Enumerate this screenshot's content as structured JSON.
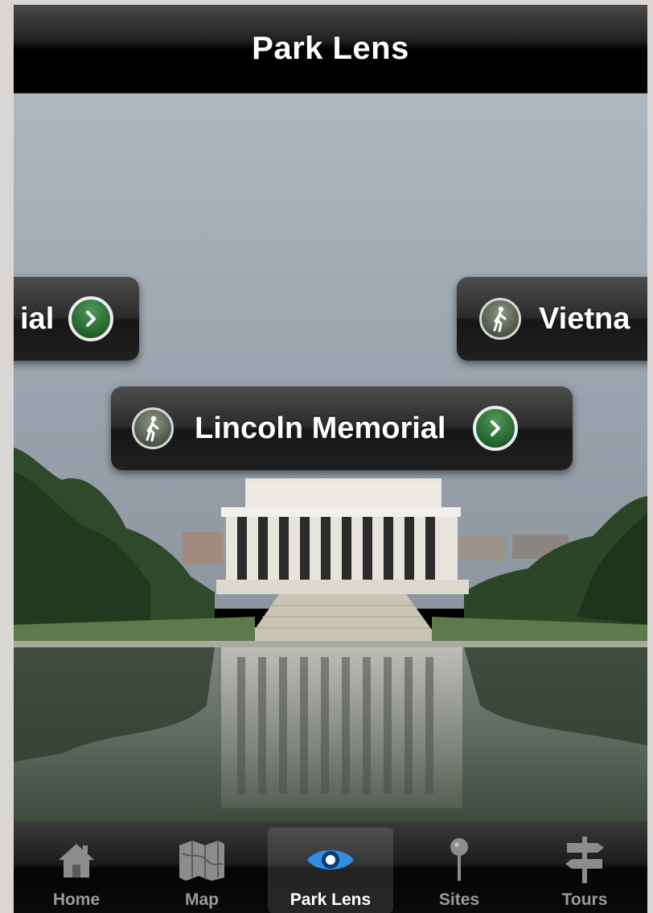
{
  "navbar": {
    "title": "Park Lens"
  },
  "callouts": {
    "left": {
      "label": "ial"
    },
    "main": {
      "label": "Lincoln Memorial"
    },
    "right": {
      "label": "Vietna"
    }
  },
  "tabs": [
    {
      "label": "Home",
      "icon": "home-icon"
    },
    {
      "label": "Map",
      "icon": "map-icon"
    },
    {
      "label": "Park Lens",
      "icon": "eye-icon",
      "active": true
    },
    {
      "label": "Sites",
      "icon": "pin-icon"
    },
    {
      "label": "Tours",
      "icon": "signpost-icon"
    }
  ],
  "colors": {
    "accent_blue": "#2f8fe0",
    "go_green": "#2e7a3a",
    "tab_inactive": "#9a9a9a"
  }
}
